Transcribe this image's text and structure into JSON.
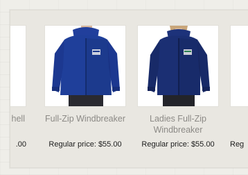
{
  "carousel": {
    "items": [
      {
        "title": "hell",
        "price": ".00",
        "image": "jacket-partial-left"
      },
      {
        "title": "Full-Zip Windbreaker",
        "price": "Regular price: $55.00",
        "image": "mens-royal-blue-windbreaker"
      },
      {
        "title": "Ladies Full-Zip Windbreaker",
        "price": "Regular price: $55.00",
        "image": "ladies-navy-windbreaker"
      },
      {
        "title": "",
        "price": "Reg",
        "image": "jacket-partial-right"
      }
    ]
  },
  "colors": {
    "jacket_royal": "#1f3f9a",
    "jacket_navy": "#1b2f73",
    "title_text": "#8c8a86",
    "price_text": "#1c1c1c",
    "panel_bg": "#e9e7e1"
  }
}
